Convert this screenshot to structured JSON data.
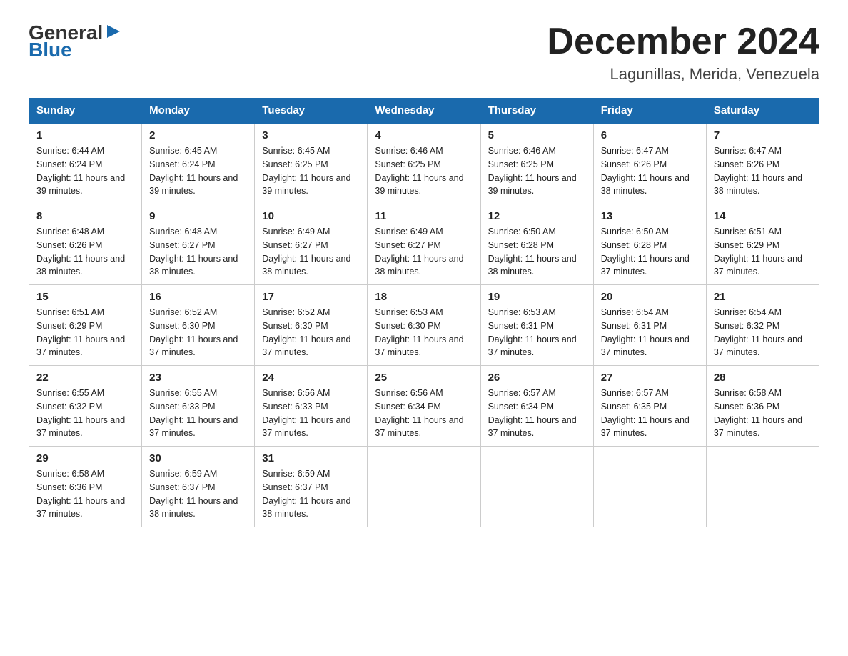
{
  "logo": {
    "top": "General",
    "bottom": "Blue",
    "arrow_symbol": "▶"
  },
  "title": "December 2024",
  "subtitle": "Lagunillas, Merida, Venezuela",
  "days_of_week": [
    "Sunday",
    "Monday",
    "Tuesday",
    "Wednesday",
    "Thursday",
    "Friday",
    "Saturday"
  ],
  "weeks": [
    [
      {
        "day": "1",
        "sunrise": "6:44 AM",
        "sunset": "6:24 PM",
        "daylight": "11 hours and 39 minutes."
      },
      {
        "day": "2",
        "sunrise": "6:45 AM",
        "sunset": "6:24 PM",
        "daylight": "11 hours and 39 minutes."
      },
      {
        "day": "3",
        "sunrise": "6:45 AM",
        "sunset": "6:25 PM",
        "daylight": "11 hours and 39 minutes."
      },
      {
        "day": "4",
        "sunrise": "6:46 AM",
        "sunset": "6:25 PM",
        "daylight": "11 hours and 39 minutes."
      },
      {
        "day": "5",
        "sunrise": "6:46 AM",
        "sunset": "6:25 PM",
        "daylight": "11 hours and 39 minutes."
      },
      {
        "day": "6",
        "sunrise": "6:47 AM",
        "sunset": "6:26 PM",
        "daylight": "11 hours and 38 minutes."
      },
      {
        "day": "7",
        "sunrise": "6:47 AM",
        "sunset": "6:26 PM",
        "daylight": "11 hours and 38 minutes."
      }
    ],
    [
      {
        "day": "8",
        "sunrise": "6:48 AM",
        "sunset": "6:26 PM",
        "daylight": "11 hours and 38 minutes."
      },
      {
        "day": "9",
        "sunrise": "6:48 AM",
        "sunset": "6:27 PM",
        "daylight": "11 hours and 38 minutes."
      },
      {
        "day": "10",
        "sunrise": "6:49 AM",
        "sunset": "6:27 PM",
        "daylight": "11 hours and 38 minutes."
      },
      {
        "day": "11",
        "sunrise": "6:49 AM",
        "sunset": "6:27 PM",
        "daylight": "11 hours and 38 minutes."
      },
      {
        "day": "12",
        "sunrise": "6:50 AM",
        "sunset": "6:28 PM",
        "daylight": "11 hours and 38 minutes."
      },
      {
        "day": "13",
        "sunrise": "6:50 AM",
        "sunset": "6:28 PM",
        "daylight": "11 hours and 37 minutes."
      },
      {
        "day": "14",
        "sunrise": "6:51 AM",
        "sunset": "6:29 PM",
        "daylight": "11 hours and 37 minutes."
      }
    ],
    [
      {
        "day": "15",
        "sunrise": "6:51 AM",
        "sunset": "6:29 PM",
        "daylight": "11 hours and 37 minutes."
      },
      {
        "day": "16",
        "sunrise": "6:52 AM",
        "sunset": "6:30 PM",
        "daylight": "11 hours and 37 minutes."
      },
      {
        "day": "17",
        "sunrise": "6:52 AM",
        "sunset": "6:30 PM",
        "daylight": "11 hours and 37 minutes."
      },
      {
        "day": "18",
        "sunrise": "6:53 AM",
        "sunset": "6:30 PM",
        "daylight": "11 hours and 37 minutes."
      },
      {
        "day": "19",
        "sunrise": "6:53 AM",
        "sunset": "6:31 PM",
        "daylight": "11 hours and 37 minutes."
      },
      {
        "day": "20",
        "sunrise": "6:54 AM",
        "sunset": "6:31 PM",
        "daylight": "11 hours and 37 minutes."
      },
      {
        "day": "21",
        "sunrise": "6:54 AM",
        "sunset": "6:32 PM",
        "daylight": "11 hours and 37 minutes."
      }
    ],
    [
      {
        "day": "22",
        "sunrise": "6:55 AM",
        "sunset": "6:32 PM",
        "daylight": "11 hours and 37 minutes."
      },
      {
        "day": "23",
        "sunrise": "6:55 AM",
        "sunset": "6:33 PM",
        "daylight": "11 hours and 37 minutes."
      },
      {
        "day": "24",
        "sunrise": "6:56 AM",
        "sunset": "6:33 PM",
        "daylight": "11 hours and 37 minutes."
      },
      {
        "day": "25",
        "sunrise": "6:56 AM",
        "sunset": "6:34 PM",
        "daylight": "11 hours and 37 minutes."
      },
      {
        "day": "26",
        "sunrise": "6:57 AM",
        "sunset": "6:34 PM",
        "daylight": "11 hours and 37 minutes."
      },
      {
        "day": "27",
        "sunrise": "6:57 AM",
        "sunset": "6:35 PM",
        "daylight": "11 hours and 37 minutes."
      },
      {
        "day": "28",
        "sunrise": "6:58 AM",
        "sunset": "6:36 PM",
        "daylight": "11 hours and 37 minutes."
      }
    ],
    [
      {
        "day": "29",
        "sunrise": "6:58 AM",
        "sunset": "6:36 PM",
        "daylight": "11 hours and 37 minutes."
      },
      {
        "day": "30",
        "sunrise": "6:59 AM",
        "sunset": "6:37 PM",
        "daylight": "11 hours and 38 minutes."
      },
      {
        "day": "31",
        "sunrise": "6:59 AM",
        "sunset": "6:37 PM",
        "daylight": "11 hours and 38 minutes."
      },
      null,
      null,
      null,
      null
    ]
  ]
}
